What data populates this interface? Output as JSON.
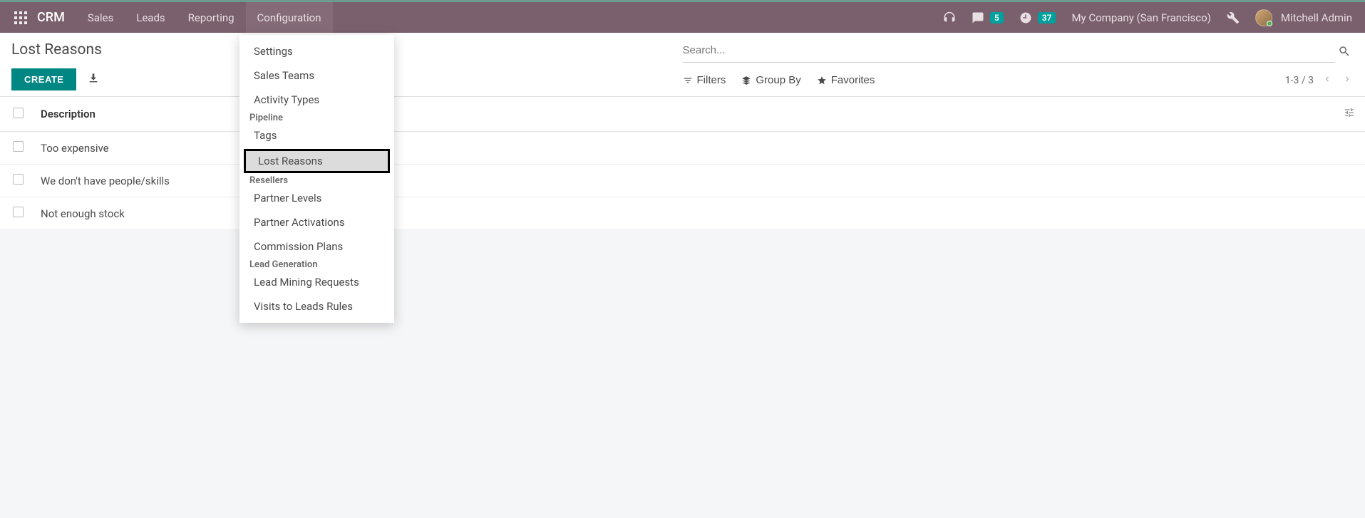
{
  "brand": "CRM",
  "nav": {
    "items": [
      {
        "label": "Sales"
      },
      {
        "label": "Leads"
      },
      {
        "label": "Reporting"
      },
      {
        "label": "Configuration",
        "active": true
      }
    ]
  },
  "navRight": {
    "messages_count": "5",
    "activities_count": "37",
    "company": "My Company (San Francisco)",
    "user": "Mitchell Admin"
  },
  "dropdown": {
    "items_top": [
      {
        "label": "Settings"
      },
      {
        "label": "Sales Teams"
      },
      {
        "label": "Activity Types"
      }
    ],
    "header_pipeline": "Pipeline",
    "items_pipeline": [
      {
        "label": "Tags"
      },
      {
        "label": "Lost Reasons",
        "highlighted": true
      }
    ],
    "header_resellers": "Resellers",
    "items_resellers": [
      {
        "label": "Partner Levels"
      },
      {
        "label": "Partner Activations"
      },
      {
        "label": "Commission Plans"
      }
    ],
    "header_leadgen": "Lead Generation",
    "items_leadgen": [
      {
        "label": "Lead Mining Requests"
      },
      {
        "label": "Visits to Leads Rules"
      }
    ]
  },
  "breadcrumb": "Lost Reasons",
  "buttons": {
    "create": "CREATE"
  },
  "search": {
    "placeholder": "Search...",
    "filters": "Filters",
    "groupby": "Group By",
    "favorites": "Favorites"
  },
  "pager": {
    "range": "1-3 / 3"
  },
  "table": {
    "header": "Description",
    "rows": [
      {
        "desc": "Too expensive"
      },
      {
        "desc": "We don't have people/skills"
      },
      {
        "desc": "Not enough stock"
      }
    ]
  }
}
